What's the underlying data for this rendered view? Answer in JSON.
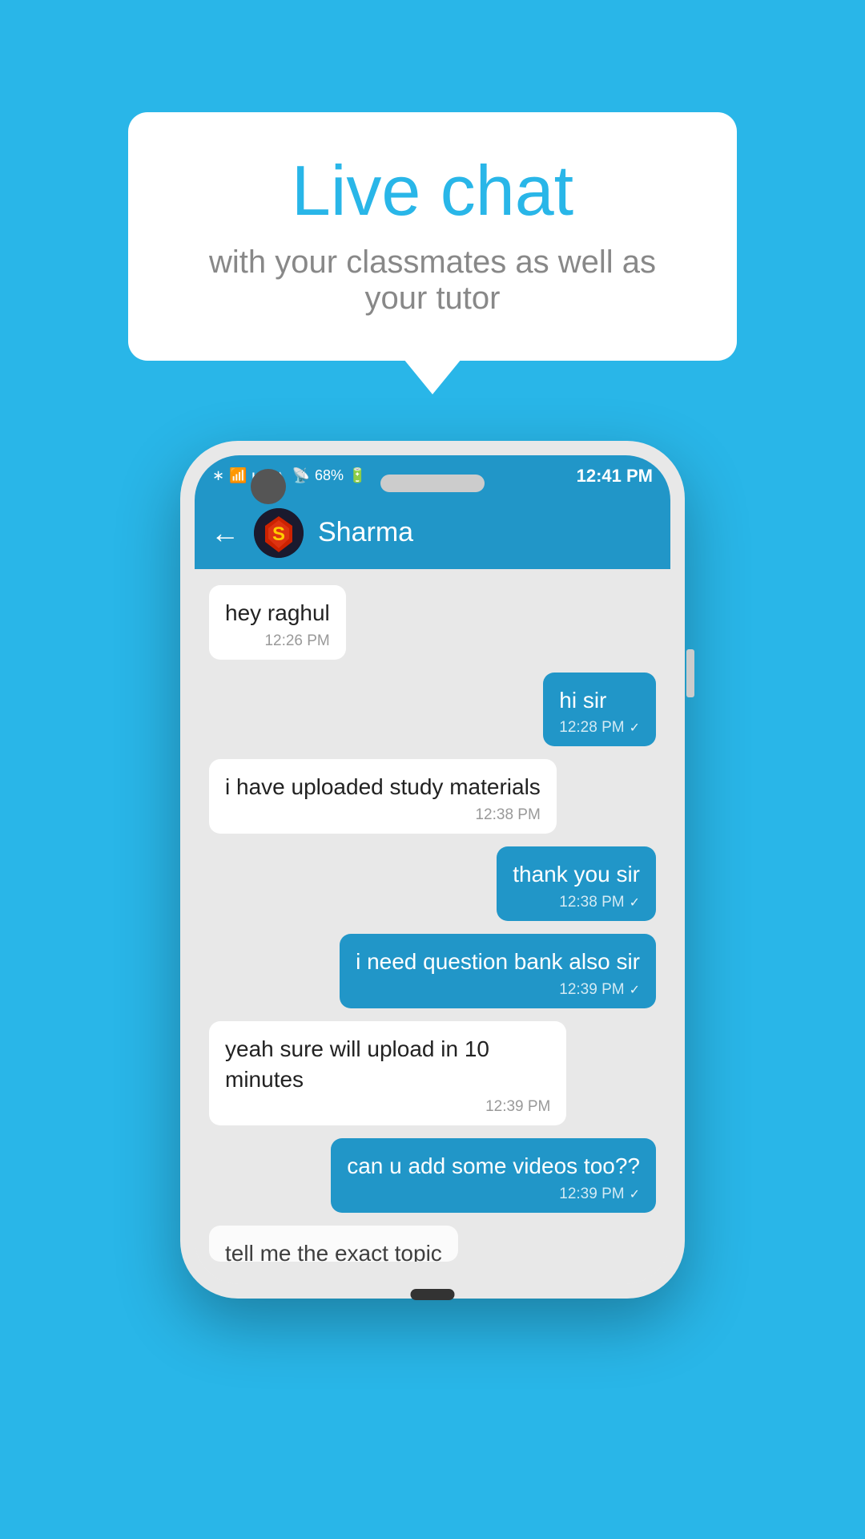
{
  "background_color": "#29b6e8",
  "bubble": {
    "title": "Live chat",
    "subtitle": "with your classmates as well as your tutor"
  },
  "phone": {
    "status_bar": {
      "time": "12:41 PM",
      "battery": "68%"
    },
    "header": {
      "contact_name": "Sharma",
      "back_label": "←"
    },
    "messages": [
      {
        "id": 1,
        "type": "received",
        "text": "hey raghul",
        "time": "12:26 PM",
        "check": ""
      },
      {
        "id": 2,
        "type": "sent",
        "text": "hi sir",
        "time": "12:28 PM",
        "check": "✓"
      },
      {
        "id": 3,
        "type": "received",
        "text": "i have uploaded study materials",
        "time": "12:38 PM",
        "check": ""
      },
      {
        "id": 4,
        "type": "sent",
        "text": "thank you sir",
        "time": "12:38 PM",
        "check": "✓"
      },
      {
        "id": 5,
        "type": "sent",
        "text": "i need question bank also sir",
        "time": "12:39 PM",
        "check": "✓"
      },
      {
        "id": 6,
        "type": "received",
        "text": "yeah sure will upload in 10 minutes",
        "time": "12:39 PM",
        "check": ""
      },
      {
        "id": 7,
        "type": "sent",
        "text": "can u add some videos too??",
        "time": "12:39 PM",
        "check": "✓"
      },
      {
        "id": 8,
        "type": "received",
        "text": "tell me the exact topic",
        "time": "",
        "partial": true
      }
    ]
  }
}
